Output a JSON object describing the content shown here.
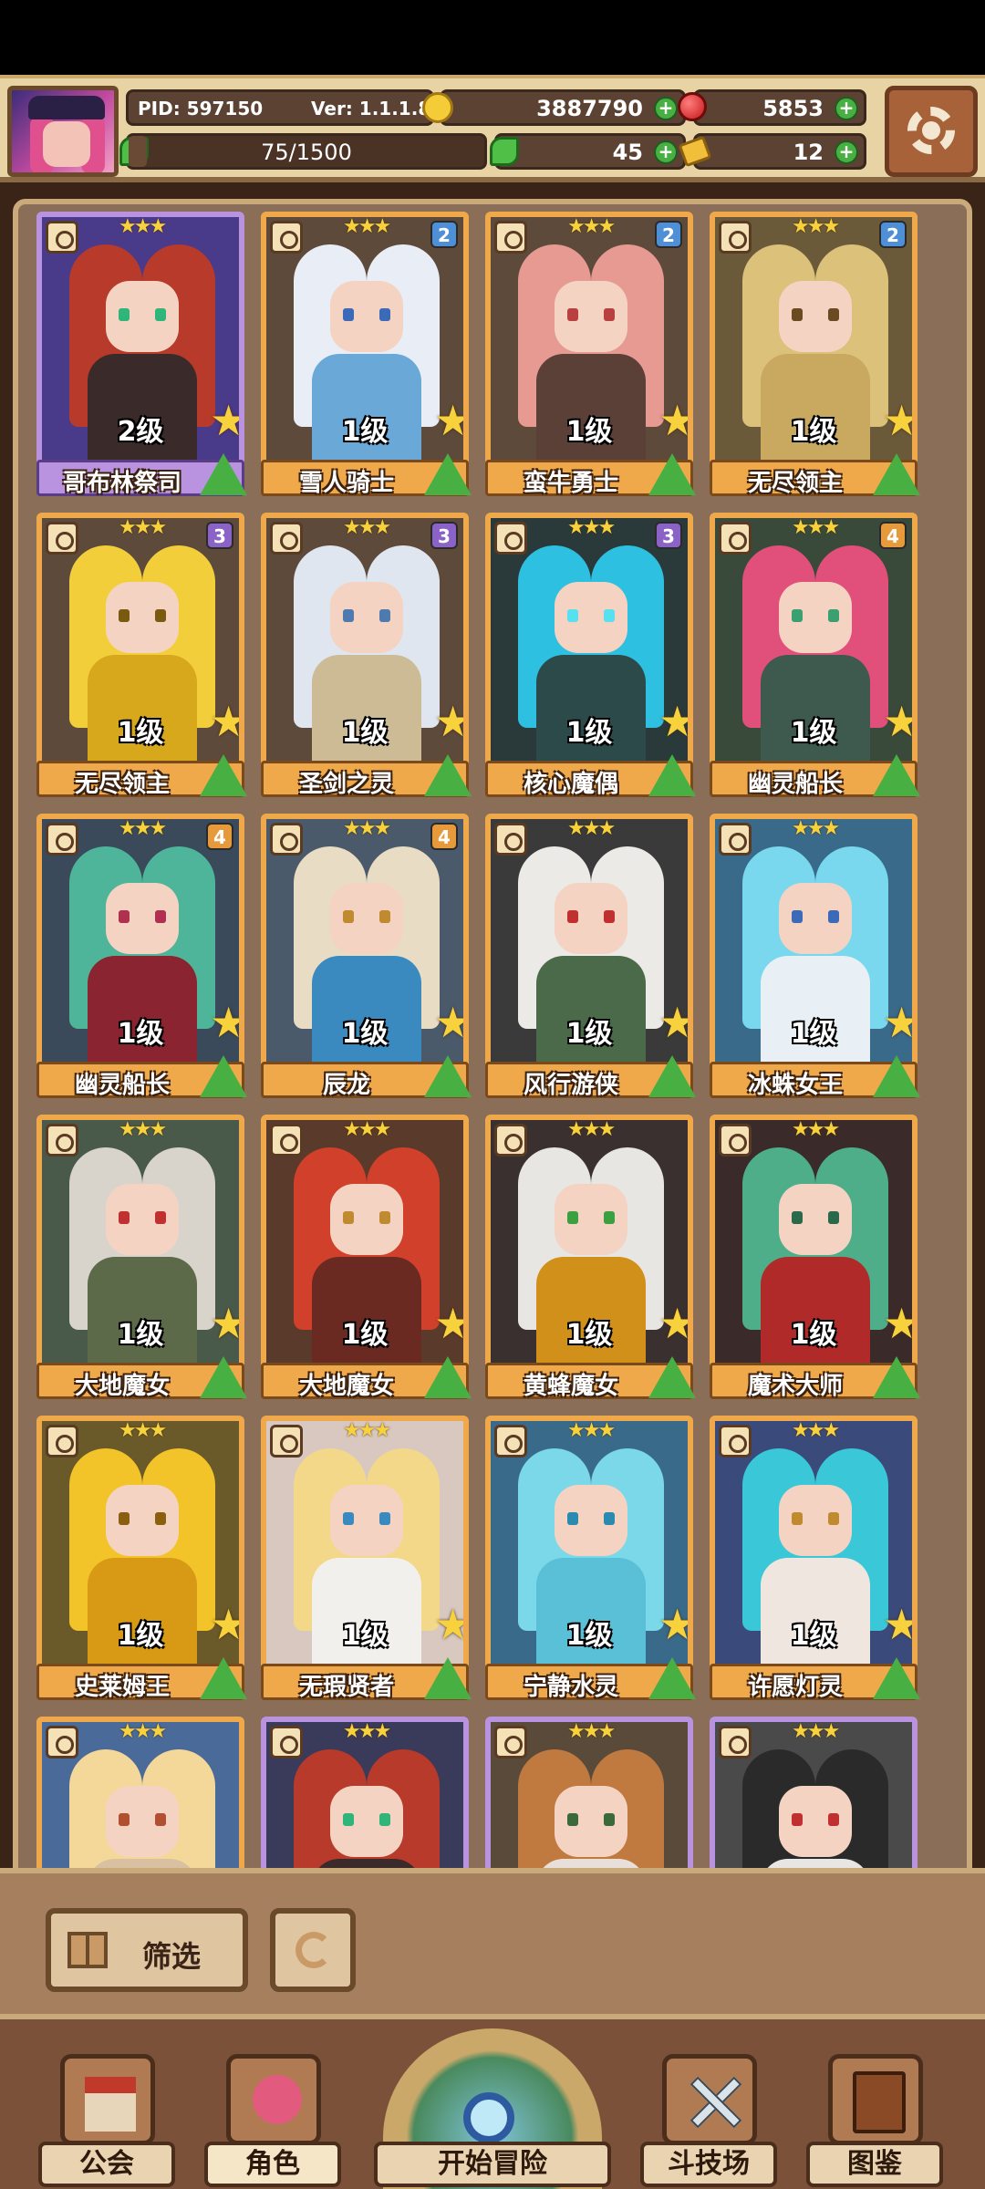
{
  "header": {
    "pid": "PID: 597150",
    "version": "Ver: 1.1.1.8",
    "gold": "3887790",
    "gems": "5853",
    "exp": "75/1500",
    "exp_ratio": 0.05,
    "clover": "45",
    "tickets": "12",
    "plus": "+"
  },
  "cards": [
    {
      "name": "哥布林祭司",
      "level": "2级",
      "tier": "",
      "frame": "purple",
      "bg": "#4a3a8a",
      "hair": "#b83a2a",
      "body": "#3b2a2a",
      "eye": "#2fb57a"
    },
    {
      "name": "雪人骑士",
      "level": "1级",
      "tier": "2",
      "frame": "orange",
      "bg": "#5d4a3a",
      "hair": "#e9eef6",
      "body": "#6aa8d8",
      "eye": "#3b6ab8"
    },
    {
      "name": "蛮牛勇士",
      "level": "1级",
      "tier": "2",
      "frame": "orange",
      "bg": "#5d4a3a",
      "hair": "#e79a92",
      "body": "#5b4038",
      "eye": "#b84040"
    },
    {
      "name": "无尽领主",
      "level": "1级",
      "tier": "2",
      "frame": "orange",
      "bg": "#6b5a3a",
      "hair": "#dcc17a",
      "body": "#c9a860",
      "eye": "#6a4a20"
    },
    {
      "name": "无尽领主",
      "level": "1级",
      "tier": "3",
      "frame": "orange",
      "bg": "#5d4a3a",
      "hair": "#f2cf3a",
      "body": "#d8a81c",
      "eye": "#7a5a10"
    },
    {
      "name": "圣剑之灵",
      "level": "1级",
      "tier": "3",
      "frame": "orange",
      "bg": "#5d4a3a",
      "hair": "#dfe6f0",
      "body": "#cdbb96",
      "eye": "#4f7ab0"
    },
    {
      "name": "核心魔偶",
      "level": "1级",
      "tier": "3",
      "frame": "orange",
      "bg": "#2a3a3a",
      "hair": "#2ec0e0",
      "body": "#2d4a4a",
      "eye": "#56e0f0"
    },
    {
      "name": "幽灵船长",
      "level": "1级",
      "tier": "4",
      "frame": "orange",
      "bg": "#3a4a3a",
      "hair": "#e0507a",
      "body": "#3e5a4e",
      "eye": "#3aa070"
    },
    {
      "name": "幽灵船长",
      "level": "1级",
      "tier": "4",
      "frame": "orange",
      "bg": "#3a4a5a",
      "hair": "#4fb59a",
      "body": "#8a2430",
      "eye": "#b03050"
    },
    {
      "name": "辰龙",
      "level": "1级",
      "tier": "4",
      "frame": "orange",
      "bg": "#4a5a6a",
      "hair": "#e8dcc4",
      "body": "#3a8ac0",
      "eye": "#c08a30"
    },
    {
      "name": "风行游侠",
      "level": "1级",
      "tier": "",
      "frame": "orange",
      "bg": "#3a3a3a",
      "hair": "#eceae6",
      "body": "#4a6a4a",
      "eye": "#c03030"
    },
    {
      "name": "冰蛛女王",
      "level": "1级",
      "tier": "",
      "frame": "orange",
      "bg": "#3a6a8a",
      "hair": "#7ad8ee",
      "body": "#e8f0f6",
      "eye": "#3a6ab8"
    },
    {
      "name": "大地魔女",
      "level": "1级",
      "tier": "",
      "frame": "orange",
      "bg": "#4a5a4a",
      "hair": "#d8d4cc",
      "body": "#5c6a4a",
      "eye": "#c03030"
    },
    {
      "name": "大地魔女",
      "level": "1级",
      "tier": "",
      "frame": "orange",
      "bg": "#5a3a2a",
      "hair": "#d0402a",
      "body": "#6a2a22",
      "eye": "#c08a30"
    },
    {
      "name": "黄蜂魔女",
      "level": "1级",
      "tier": "",
      "frame": "orange",
      "bg": "#3a3030",
      "hair": "#e8e6e2",
      "body": "#d0901a",
      "eye": "#3aa040"
    },
    {
      "name": "魔术大师",
      "level": "1级",
      "tier": "",
      "frame": "orange",
      "bg": "#3a2a2a",
      "hair": "#4fae8a",
      "body": "#b02a2a",
      "eye": "#2a6a4a"
    },
    {
      "name": "史莱姆王",
      "level": "1级",
      "tier": "",
      "frame": "orange",
      "bg": "#6a5a2a",
      "hair": "#f2c42a",
      "body": "#d89a14",
      "eye": "#8a6010"
    },
    {
      "name": "无瑕贤者",
      "level": "1级",
      "tier": "",
      "frame": "orange",
      "bg": "#d8c8c0",
      "hair": "#f4d88a",
      "body": "#f2f0ec",
      "eye": "#3a8ac0"
    },
    {
      "name": "宁静水灵",
      "level": "1级",
      "tier": "",
      "frame": "orange",
      "bg": "#3a6a8a",
      "hair": "#7ad8e8",
      "body": "#5ac0d8",
      "eye": "#2a8ab0"
    },
    {
      "name": "许愿灯灵",
      "level": "1级",
      "tier": "",
      "frame": "orange",
      "bg": "#3a4a7a",
      "hair": "#3ac8d8",
      "body": "#f0e6e0",
      "eye": "#c08a30"
    },
    {
      "name": "",
      "level": "",
      "tier": "",
      "frame": "orange",
      "bg": "#4a6a9a",
      "hair": "#f4d89a",
      "body": "#d8c0a0",
      "eye": "#b05030"
    },
    {
      "name": "",
      "level": "",
      "tier": "",
      "frame": "purple",
      "bg": "#3a3a5a",
      "hair": "#b83a2a",
      "body": "#3b2a2a",
      "eye": "#2fb57a"
    },
    {
      "name": "",
      "level": "",
      "tier": "",
      "frame": "purple",
      "bg": "#5a4a3a",
      "hair": "#c07a40",
      "body": "#e8e0d8",
      "eye": "#3a6a3a"
    },
    {
      "name": "",
      "level": "",
      "tier": "",
      "frame": "purple",
      "bg": "#4a4a4a",
      "hair": "#2a2a2a",
      "body": "#e8e6e2",
      "eye": "#c03030"
    }
  ],
  "filter": {
    "label": "筛选"
  },
  "nav": {
    "guild": "公会",
    "character": "角色",
    "adventure": "开始冒险",
    "arena": "斗技场",
    "codex": "图鉴"
  }
}
